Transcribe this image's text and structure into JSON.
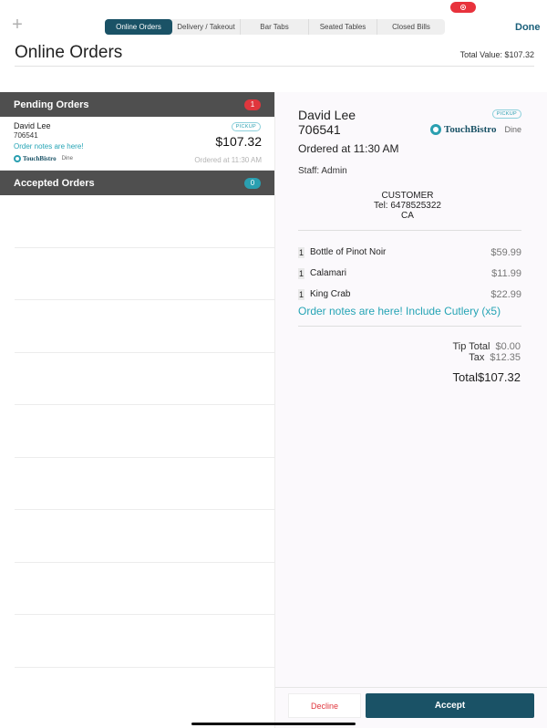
{
  "colors": {
    "accent": "#1a5266",
    "teal": "#2a9fb0",
    "danger": "#e0363d",
    "section_bar": "#4f4f4f"
  },
  "toolbar": {
    "add_icon": "plus-icon",
    "tabs": [
      {
        "label": "Online Orders",
        "active": true
      },
      {
        "label": "Delivery / Takeout",
        "active": false
      },
      {
        "label": "Bar Tabs",
        "active": false
      },
      {
        "label": "Seated Tables",
        "active": false
      },
      {
        "label": "Closed Bills",
        "active": false
      }
    ],
    "done_label": "Done",
    "recording_icon": "screen-record-icon"
  },
  "header": {
    "title": "Online Orders",
    "total_value": "Total Value: $107.32"
  },
  "pending": {
    "label": "Pending Orders",
    "count": "1",
    "orders": [
      {
        "name": "David Lee",
        "number": "706541",
        "notes": "Order notes are here!",
        "brand": "TouchBistro",
        "mode": "Dine",
        "tag": "PICKUP",
        "price": "$107.32",
        "time": "Ordered at 11:30 AM"
      }
    ]
  },
  "accepted": {
    "label": "Accepted Orders",
    "count": "0"
  },
  "detail": {
    "name": "David Lee",
    "number": "706541",
    "tag": "PICKUP",
    "brand": "TouchBistro",
    "mode": "Dine",
    "ordered_at": "Ordered at 11:30 AM",
    "staff": "Staff: Admin",
    "customer": {
      "heading": "CUSTOMER",
      "tel": "Tel: 6478525322",
      "region": "CA"
    },
    "items": [
      {
        "qty": "1",
        "name": "Bottle of Pinot Noir",
        "price": "$59.99"
      },
      {
        "qty": "1",
        "name": "Calamari",
        "price": "$11.99"
      },
      {
        "qty": "1",
        "name": "King Crab",
        "price": "$22.99"
      }
    ],
    "notes": "Order notes are here! Include Cutlery (x5)",
    "tip_label": "Tip Total",
    "tip_value": "$0.00",
    "tax_label": "Tax",
    "tax_value": "$12.35",
    "total_label": "Total",
    "total_value": "$107.32"
  },
  "footer": {
    "decline_label": "Decline",
    "accept_label": "Accept"
  }
}
